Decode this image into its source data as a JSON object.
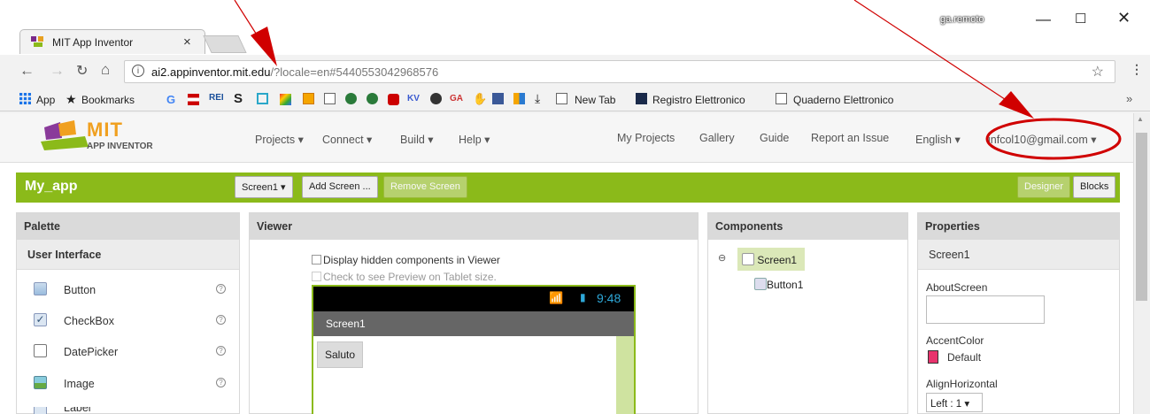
{
  "browser": {
    "tab_title": "MIT App Inventor",
    "tab_close": "×",
    "user_name": "ga.remoto",
    "url_domain": "ai2.appinventor.mit.edu",
    "url_rest": "/?locale=en#5440553042968576",
    "bookmarks": [
      "App",
      "Bookmarks",
      "New Tab",
      "Registro Elettronico",
      "Quaderno Elettronico"
    ]
  },
  "app": {
    "logo_main": "MIT",
    "logo_sub": "APP INVENTOR",
    "menu": [
      "Projects ▾",
      "Connect ▾",
      "Build ▾",
      "Help ▾"
    ],
    "links": [
      "My Projects",
      "Gallery",
      "Guide",
      "Report an Issue",
      "English ▾"
    ],
    "account": "infcol10@gmail.com ▾",
    "project_name": "My_app",
    "screen_select": "Screen1 ▾",
    "add_screen": "Add Screen ...",
    "remove_screen": "Remove Screen",
    "designer": "Designer",
    "blocks": "Blocks"
  },
  "palette": {
    "title": "Palette",
    "category": "User Interface",
    "items": [
      "Button",
      "CheckBox",
      "DatePicker",
      "Image",
      "Label"
    ],
    "help": "?"
  },
  "viewer": {
    "title": "Viewer",
    "hidden_label": "Display hidden components in Viewer",
    "tablet_label": "Check to see Preview on Tablet size.",
    "time": "9:48",
    "screen_title": "Screen1",
    "button_text": "Saluto"
  },
  "components": {
    "title": "Components",
    "root": "Screen1",
    "child": "Button1",
    "toggle": "⊖"
  },
  "properties": {
    "title": "Properties",
    "component": "Screen1",
    "about_label": "AboutScreen",
    "accent_label": "AccentColor",
    "accent_value": "Default",
    "accent_color": "#e8336d",
    "align_label": "AlignHorizontal",
    "align_value": "Left : 1 ▾"
  },
  "colors": {
    "brand_green": "#8bba1a",
    "annotation_red": "#d00000"
  }
}
